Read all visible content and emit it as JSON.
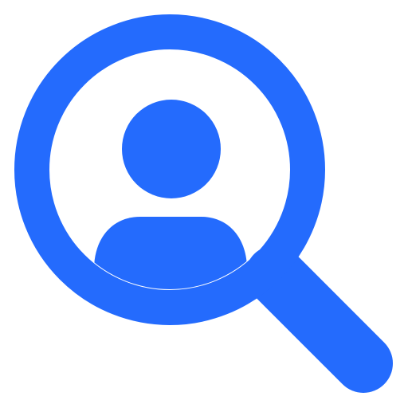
{
  "icon": {
    "name": "user-search-icon",
    "color": "#246BFD",
    "background": "#ffffff"
  }
}
